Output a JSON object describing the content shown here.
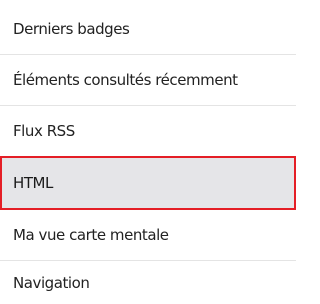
{
  "menu": {
    "items": [
      {
        "label": "Derniers badges"
      },
      {
        "label": "Éléments consultés récemment"
      },
      {
        "label": "Flux RSS"
      },
      {
        "label": "HTML"
      },
      {
        "label": "Ma vue carte mentale"
      },
      {
        "label": "Navigation"
      }
    ],
    "selected_label": "HTML"
  }
}
